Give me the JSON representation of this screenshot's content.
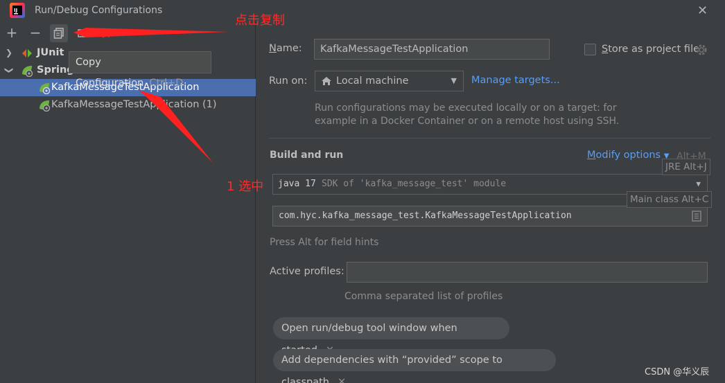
{
  "window": {
    "title": "Run/Debug Configurations",
    "close_icon": "close-icon"
  },
  "toolbar": {
    "add_label": "+",
    "remove_label": "−",
    "copy_icon": "copy-icon"
  },
  "tree": {
    "junit_label": "JUnit",
    "spring_label": "Spring",
    "items": [
      {
        "label": "KafkaMessageTestApplication",
        "selected": true
      },
      {
        "label": "KafkaMessageTestApplication (1)",
        "selected": false
      }
    ]
  },
  "tooltip": {
    "label": "Copy Configuration",
    "shortcut": "Ctrl+D"
  },
  "annotations": {
    "copy_note": "点击复制",
    "select_note": "1 选中"
  },
  "form": {
    "name_label": "Name:",
    "name_value": "KafkaMessageTestApplication",
    "store_label": "Store as project file",
    "run_on_label": "Run on:",
    "run_on_value": "Local machine",
    "manage_targets": "Manage targets...",
    "run_on_hint_1": "Run configurations may be executed locally or on a target: for",
    "run_on_hint_2": "example in a Docker Container or on a remote host using SSH.",
    "build_run_title": "Build and run",
    "modify_options": "Modify options",
    "modify_shortcut": "Alt+M",
    "jre_hint": "JRE Alt+J",
    "jre_value_prefix": "java 17",
    "jre_value_suffix": "SDK of 'kafka_message_test' module",
    "main_class_hint": "Main class Alt+C",
    "main_class_value": "com.hyc.kafka_message_test.KafkaMessageTestApplication",
    "field_hints_note": "Press Alt for field hints",
    "active_profiles_label": "Active profiles:",
    "active_profiles_value": "",
    "active_profiles_hint": "Comma separated list of profiles",
    "tags": [
      "Open run/debug tool window when started",
      "Add dependencies with “provided” scope to classpath"
    ]
  },
  "watermark": "CSDN @华义辰",
  "colors": {
    "background": "#3c3f41",
    "selection": "#4b6eaf",
    "link": "#589df6",
    "annotation": "#ff2a2a"
  }
}
